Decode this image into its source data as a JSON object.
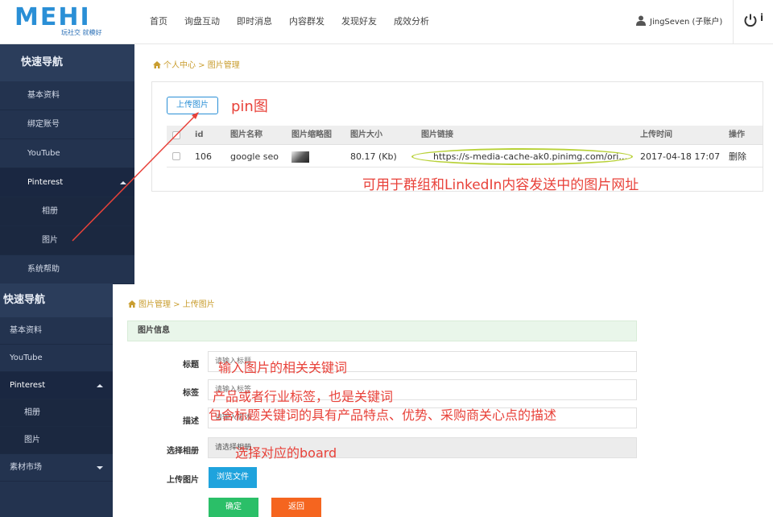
{
  "header": {
    "logo_text": "MEHI",
    "logo_slogan": "玩社交 就模好",
    "nav": [
      "首页",
      "询盘互动",
      "即时消息",
      "内容群发",
      "发现好友",
      "成效分析"
    ],
    "user_label": "JingSeven (子账户)",
    "power_tail": "i"
  },
  "sidebar": {
    "title": "快速导航",
    "items": [
      "基本资料",
      "绑定账号",
      "YouTube",
      "Pinterest",
      "相册",
      "图片",
      "系统帮助"
    ]
  },
  "top_panel": {
    "breadcrumb": "个人中心 > 图片管理",
    "upload_button": "上传图片",
    "columns": [
      "id",
      "图片名称",
      "图片缩略图",
      "图片大小",
      "图片链接",
      "上传时间",
      "操作"
    ],
    "rows": [
      {
        "id": "106",
        "name": "google seo",
        "size": "80.17 (Kb)",
        "link": "https://s-media-cache-ak0.pinimg.com/originals/e...",
        "time": "2017-04-18 17:07",
        "action": "删除"
      }
    ]
  },
  "annotations": {
    "pin": "pin图",
    "url": "可用于群组和LinkedIn内容发送中的图片网址",
    "title": "输入图片的相关关键词",
    "tags": "产品或者行业标签，也是关键词",
    "desc": "包含标题关键词的具有产品特点、优势、采购商关心点的描述",
    "album": "选择对应的board"
  },
  "sidebar2": {
    "title": "快速导航",
    "items": [
      "基本资料",
      "YouTube",
      "Pinterest",
      "相册",
      "图片",
      "素材市场"
    ]
  },
  "form": {
    "breadcrumb": "图片管理 > 上传图片",
    "section_title": "图片信息",
    "title_label": "标题",
    "title_placeholder": "请输入标题",
    "tags_label": "标签",
    "tags_placeholder": "请输入标签",
    "desc_label": "描述",
    "desc_placeholder": "请输入描述",
    "album_label": "选择相册",
    "album_value": "请选择相册",
    "upload_label": "上传图片",
    "browse_button": "浏览文件",
    "confirm_button": "确定",
    "back_button": "返回"
  },
  "colors": {
    "brand": "#2a8fd6",
    "sidebar": "#23334f",
    "annotation": "#e8423a",
    "highlight": "#b8d138",
    "confirm": "#2bbf68",
    "back": "#f5651f"
  }
}
